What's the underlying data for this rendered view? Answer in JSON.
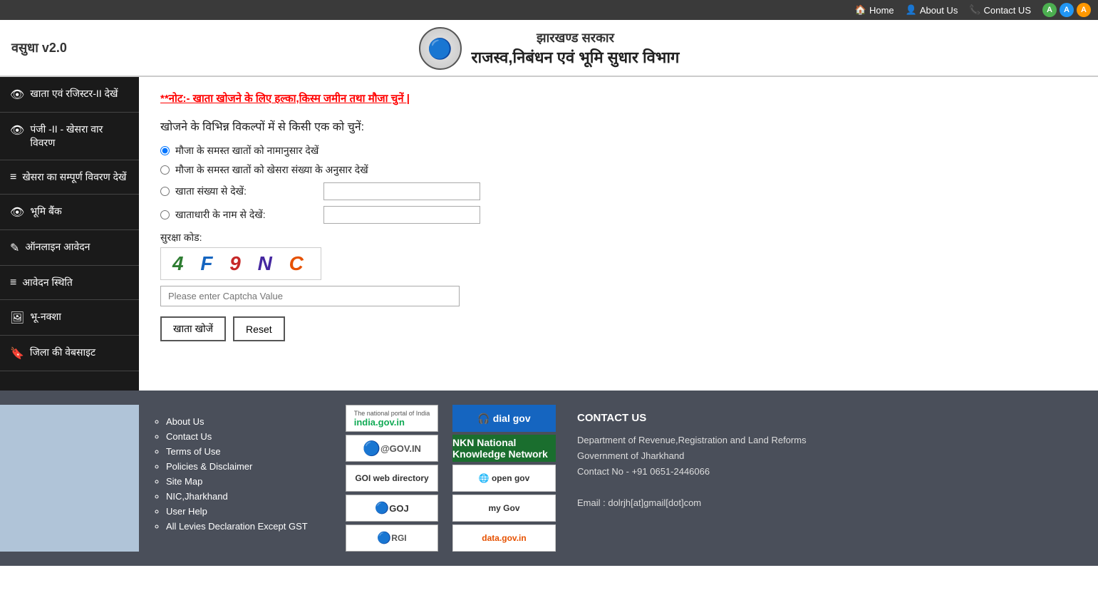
{
  "topnav": {
    "home": "Home",
    "about": "About Us",
    "contact": "Contact US"
  },
  "fontBtns": [
    "A",
    "A",
    "A"
  ],
  "header": {
    "vasudha": "वसुधा v2.0",
    "gov_name": "झारखण्ड सरकार",
    "dept_name": "राजस्व,निबंधन एवं भूमि सुधार विभाग"
  },
  "sidebar": {
    "items": [
      {
        "icon": "👁",
        "label": "खाता एवं रजिस्टर-II देखें"
      },
      {
        "icon": "👁",
        "label": "पंजी -II - खेसरा वार विवरण"
      },
      {
        "icon": "≡",
        "label": "खेसरा का सम्पूर्ण विवरण देखें"
      },
      {
        "icon": "👁",
        "label": "भूमि बैंक"
      },
      {
        "icon": "✎",
        "label": "ऑनलाइन आवेदन"
      },
      {
        "icon": "≡",
        "label": "आवेदन स्थिति"
      },
      {
        "icon": "🖼",
        "label": "भू-नक्शा"
      },
      {
        "icon": "🔖",
        "label": "जिला की वेबसाइट"
      }
    ]
  },
  "content": {
    "note": "**नोट:- खाता खोजने के लिए हल्का,किस्म जमीन तथा मौजा चुनें |",
    "search_heading": "खोजने के विभिन्न विकल्पों में से किसी एक को चुनें:",
    "radio1": "मौजा के समस्त खातों को नामानुसार देखें",
    "radio2": "मौजा के समस्त खातों को खेसरा संख्या के अनुसार देखें",
    "radio3_label": "खाता संख्या से देखें:",
    "radio4_label": "खाताधारी के नाम से देखें:",
    "security_label": "सुरक्षा कोड:",
    "captcha": "4 F 9 N C",
    "captcha_placeholder": "Please enter Captcha Value",
    "btn_search": "खाता खोजें",
    "btn_reset": "Reset"
  },
  "footer": {
    "links": [
      "About Us",
      "Contact Us",
      "Terms of Use",
      "Policies & Disclaimer",
      "Site Map",
      "NIC,Jharkhand",
      "User Help",
      "All Levies Declaration Except GST"
    ],
    "logos_col1": [
      {
        "label": "india.gov.in",
        "sub": "The national portal of India"
      },
      {
        "label": "@GOV.IN"
      },
      {
        "label": "GOI web directory"
      },
      {
        "label": "GOJ"
      },
      {
        "label": "RGI"
      }
    ],
    "logos_col2": [
      {
        "label": "dial gov",
        "style": "dial"
      },
      {
        "label": "National Knowledge Network",
        "style": "nkn"
      },
      {
        "label": "open gov",
        "style": "opengov"
      },
      {
        "label": "my Gov",
        "style": "mygov"
      },
      {
        "label": "data.gov.in",
        "style": "datagov"
      }
    ],
    "contact": {
      "title": "CONTACT US",
      "dept": "Department of Revenue,Registration and Land Reforms",
      "gov": "Government of Jharkhand",
      "phone": "Contact No - +91 0651-2446066",
      "email": "Email : dolrjh[at]gmail[dot]com"
    }
  }
}
